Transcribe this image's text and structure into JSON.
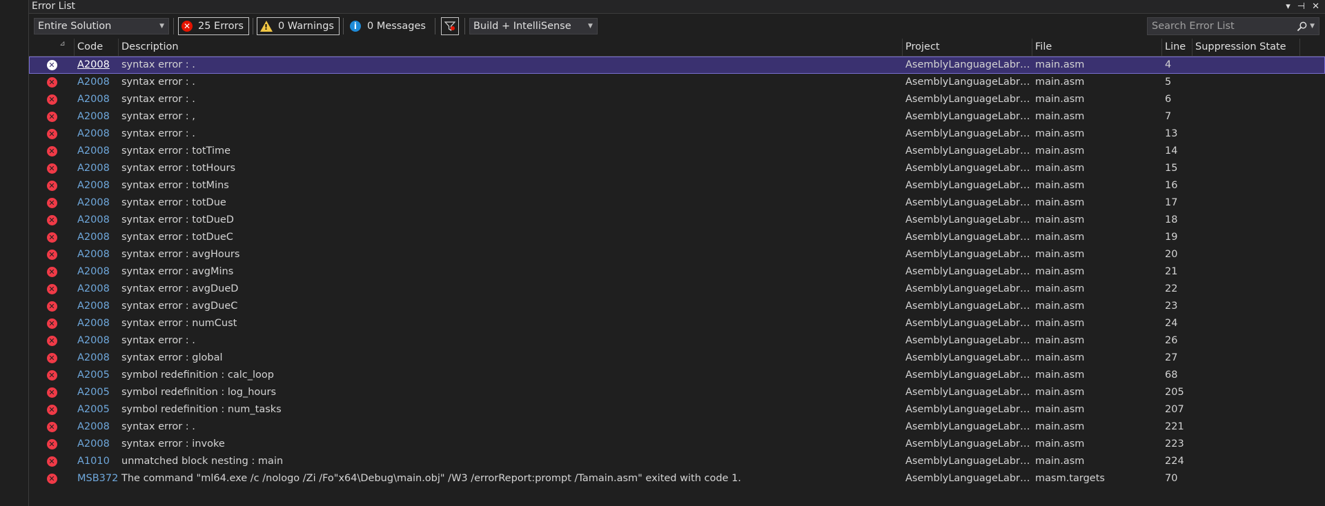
{
  "window": {
    "title": "Error List",
    "controls": [
      "▾",
      "⊣",
      "✕"
    ]
  },
  "toolbar": {
    "scope": "Entire Solution",
    "errors_label": "25 Errors",
    "warnings_label": "0 Warnings",
    "messages_label": "0 Messages",
    "build_filter": "Build + IntelliSense",
    "search_placeholder": "Search Error List"
  },
  "columns": {
    "code": "Code",
    "description": "Description",
    "project": "Project",
    "file": "File",
    "line": "Line",
    "suppression": "Suppression State"
  },
  "rows": [
    {
      "code": "A2008",
      "desc": "syntax error : .",
      "project": "AsemblyLanguageLabrato...",
      "file": "main.asm",
      "line": "4",
      "selected": true
    },
    {
      "code": "A2008",
      "desc": "syntax error : .",
      "project": "AsemblyLanguageLabrato...",
      "file": "main.asm",
      "line": "5"
    },
    {
      "code": "A2008",
      "desc": "syntax error : .",
      "project": "AsemblyLanguageLabrato...",
      "file": "main.asm",
      "line": "6"
    },
    {
      "code": "A2008",
      "desc": "syntax error : ,",
      "project": "AsemblyLanguageLabrato...",
      "file": "main.asm",
      "line": "7"
    },
    {
      "code": "A2008",
      "desc": "syntax error : .",
      "project": "AsemblyLanguageLabrato...",
      "file": "main.asm",
      "line": "13"
    },
    {
      "code": "A2008",
      "desc": "syntax error : totTime",
      "project": "AsemblyLanguageLabrato...",
      "file": "main.asm",
      "line": "14"
    },
    {
      "code": "A2008",
      "desc": "syntax error : totHours",
      "project": "AsemblyLanguageLabrato...",
      "file": "main.asm",
      "line": "15"
    },
    {
      "code": "A2008",
      "desc": "syntax error : totMins",
      "project": "AsemblyLanguageLabrato...",
      "file": "main.asm",
      "line": "16"
    },
    {
      "code": "A2008",
      "desc": "syntax error : totDue",
      "project": "AsemblyLanguageLabrato...",
      "file": "main.asm",
      "line": "17"
    },
    {
      "code": "A2008",
      "desc": "syntax error : totDueD",
      "project": "AsemblyLanguageLabrato...",
      "file": "main.asm",
      "line": "18"
    },
    {
      "code": "A2008",
      "desc": "syntax error : totDueC",
      "project": "AsemblyLanguageLabrato...",
      "file": "main.asm",
      "line": "19"
    },
    {
      "code": "A2008",
      "desc": "syntax error : avgHours",
      "project": "AsemblyLanguageLabrato...",
      "file": "main.asm",
      "line": "20"
    },
    {
      "code": "A2008",
      "desc": "syntax error : avgMins",
      "project": "AsemblyLanguageLabrato...",
      "file": "main.asm",
      "line": "21"
    },
    {
      "code": "A2008",
      "desc": "syntax error : avgDueD",
      "project": "AsemblyLanguageLabrato...",
      "file": "main.asm",
      "line": "22"
    },
    {
      "code": "A2008",
      "desc": "syntax error : avgDueC",
      "project": "AsemblyLanguageLabrato...",
      "file": "main.asm",
      "line": "23"
    },
    {
      "code": "A2008",
      "desc": "syntax error : numCust",
      "project": "AsemblyLanguageLabrato...",
      "file": "main.asm",
      "line": "24"
    },
    {
      "code": "A2008",
      "desc": "syntax error : .",
      "project": "AsemblyLanguageLabrato...",
      "file": "main.asm",
      "line": "26"
    },
    {
      "code": "A2008",
      "desc": "syntax error : global",
      "project": "AsemblyLanguageLabrato...",
      "file": "main.asm",
      "line": "27"
    },
    {
      "code": "A2005",
      "desc": "symbol redefinition : calc_loop",
      "project": "AsemblyLanguageLabrato...",
      "file": "main.asm",
      "line": "68"
    },
    {
      "code": "A2005",
      "desc": "symbol redefinition : log_hours",
      "project": "AsemblyLanguageLabrato...",
      "file": "main.asm",
      "line": "205"
    },
    {
      "code": "A2005",
      "desc": "symbol redefinition : num_tasks",
      "project": "AsemblyLanguageLabrato...",
      "file": "main.asm",
      "line": "207"
    },
    {
      "code": "A2008",
      "desc": "syntax error : .",
      "project": "AsemblyLanguageLabrato...",
      "file": "main.asm",
      "line": "221"
    },
    {
      "code": "A2008",
      "desc": "syntax error : invoke",
      "project": "AsemblyLanguageLabrato...",
      "file": "main.asm",
      "line": "223"
    },
    {
      "code": "A1010",
      "desc": "unmatched block nesting : main",
      "project": "AsemblyLanguageLabrato...",
      "file": "main.asm",
      "line": "224"
    },
    {
      "code": "MSB3721",
      "desc": "The command \"ml64.exe /c /nologo /Zi /Fo\"x64\\Debug\\main.obj\" /W3 /errorReport:prompt  /Tamain.asm\" exited with code 1.",
      "project": "AsemblyLanguageLabrato...",
      "file": "masm.targets",
      "line": "70"
    }
  ],
  "colors": {
    "selected_row": "#3a3170",
    "error_icon": "#f03a47",
    "code_link": "#6fa8dc"
  }
}
